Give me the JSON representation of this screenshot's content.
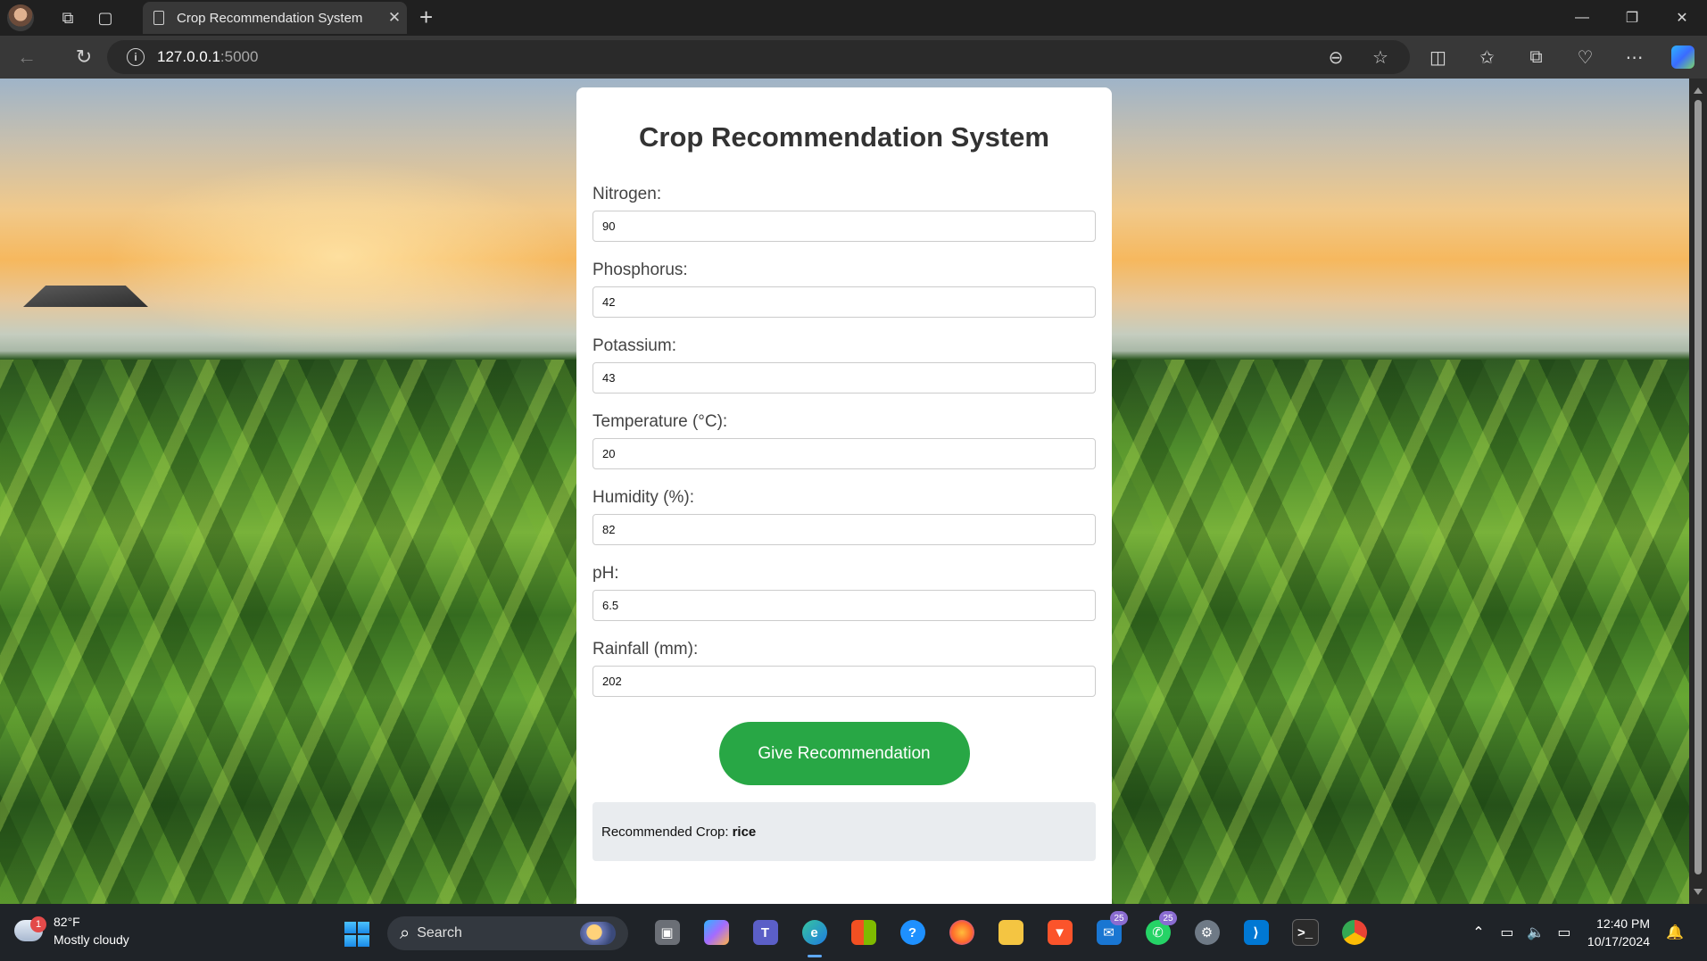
{
  "browser": {
    "tab_title": "Crop Recommendation System",
    "url_host": "127.0.0.1",
    "url_port": ":5000"
  },
  "page": {
    "title": "Crop Recommendation System",
    "fields": [
      {
        "label": "Nitrogen:",
        "value": "90"
      },
      {
        "label": "Phosphorus:",
        "value": "42"
      },
      {
        "label": "Potassium:",
        "value": "43"
      },
      {
        "label": "Temperature (°C):",
        "value": "20"
      },
      {
        "label": "Humidity (%):",
        "value": "82"
      },
      {
        "label": "pH:",
        "value": "6.5"
      },
      {
        "label": "Rainfall (mm):",
        "value": "202"
      }
    ],
    "submit_label": "Give Recommendation",
    "result_label": "Recommended Crop:",
    "result_value": "rice"
  },
  "taskbar": {
    "weather_temp": "82°F",
    "weather_desc": "Mostly cloudy",
    "weather_badge": "1",
    "search_label": "Search",
    "teams_badge": "25",
    "whatsapp_badge": "25",
    "time": "12:40 PM",
    "date": "10/17/2024"
  },
  "colors": {
    "button": "#28a745",
    "result_bg": "#e9ecef"
  }
}
